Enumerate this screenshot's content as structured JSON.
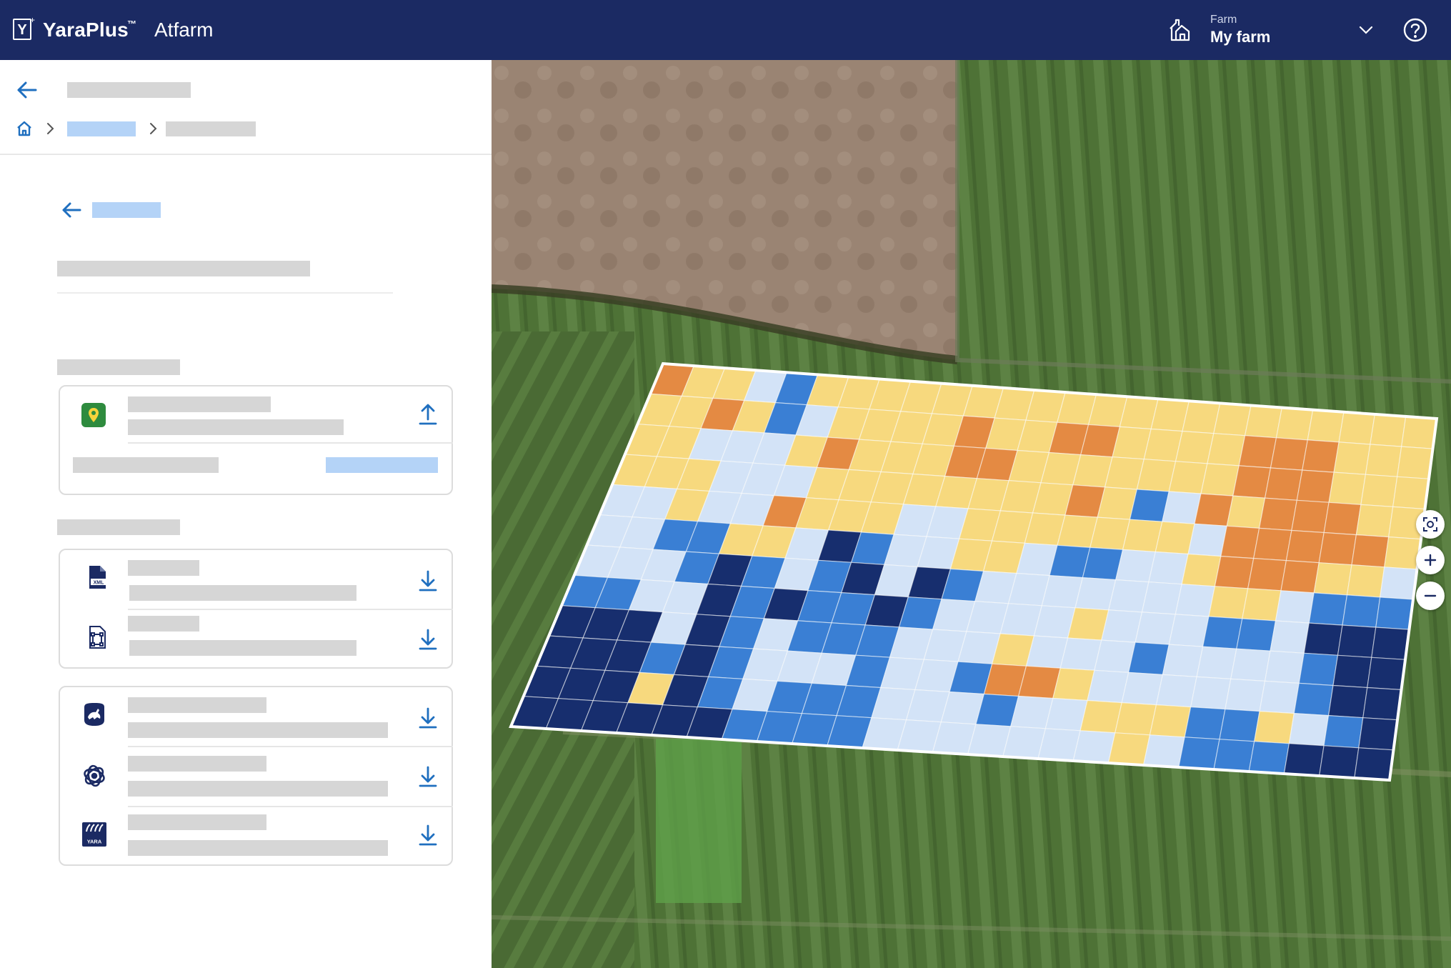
{
  "header": {
    "logo_letter": "Y",
    "brand": "YaraPlus",
    "brand_tm": "™",
    "product": "Atfarm",
    "farm_caption": "Farm",
    "farm_name": "My farm",
    "background": "#1b2a63"
  },
  "icons": {
    "back": "arrow-left-icon",
    "home": "home-icon",
    "breadcrumb_separator": "chevron-right-icon",
    "farm": "farm-house-icon",
    "farm_dropdown": "chevron-down-icon",
    "help": "help-icon",
    "upload": "upload-icon",
    "download": "download-icon",
    "map_location": "map-pin-icon",
    "xml_file": "xml-file-icon",
    "shape_file": "shape-file-icon",
    "john_deere": "john-deere-icon",
    "trimble": "trimble-icon",
    "yara": "yara-icon",
    "recenter": "recenter-icon",
    "zoom_in": "zoom-in-icon",
    "zoom_out": "zoom-out-icon"
  },
  "colors": {
    "accent_blue": "#1f6fbf",
    "skeleton_grey": "#d6d6d6",
    "skeleton_blue": "#b4d3f7",
    "zone_orange": "#e48a43",
    "zone_yellow": "#f7d97e",
    "zone_light_blue": "#d3e3f7",
    "zone_blue": "#3a7fd4",
    "zone_navy": "#172e6e"
  },
  "zone_map": {
    "legend": "0=orange,1=yellow,2=light-blue,3=blue,4=navy",
    "rows": [
      "0112311111111111111111111",
      "1101321111011001111000111",
      "1122210111001111111000111",
      "1112221111111101320100011",
      "2212201112211111112000001",
      "2233112432211233221000112",
      "2223432342432222222112333",
      "3322434334322221222332444",
      "4442432333222122232222344",
      "4443432223223001222222344",
      "4441432333222322111331234",
      "4444443333222222212333444"
    ]
  }
}
